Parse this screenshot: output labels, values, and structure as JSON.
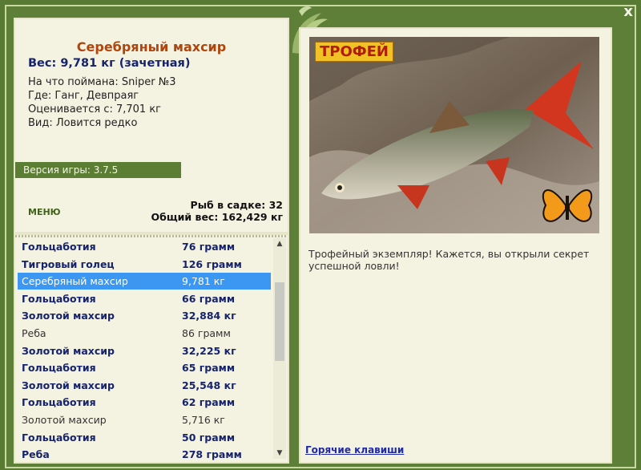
{
  "window": {
    "close_label": "x"
  },
  "fish_card": {
    "title": "Серебряный махсир",
    "weight": "Вес: 9,781 кг (зачетная)",
    "caught_on": "На что поймана: Sniper №3",
    "where": "Где: Ганг, Девпраяг",
    "valued_from": "Оценивается с: 7,701 кг",
    "kind": "Вид: Ловится редко"
  },
  "version_label": "Версия игры: 3.7.5",
  "menu_label": "МЕНЮ",
  "stats": {
    "fish_in_cage": "Рыб в садке: 32",
    "total_weight": "Общий вес: 162,429 кг"
  },
  "catch_list": [
    {
      "name": "Гольцаботия",
      "weight": "76 грамм",
      "style": "bold"
    },
    {
      "name": "Тигровый голец",
      "weight": "126 грамм",
      "style": "bold"
    },
    {
      "name": "Серебряный махсир",
      "weight": "9,781 кг",
      "style": "sel"
    },
    {
      "name": "Гольцаботия",
      "weight": "66 грамм",
      "style": "bold"
    },
    {
      "name": "Золотой махсир",
      "weight": "32,884 кг",
      "style": "bold"
    },
    {
      "name": "Реба",
      "weight": "86 грамм",
      "style": "plain"
    },
    {
      "name": "Золотой махсир",
      "weight": "32,225 кг",
      "style": "bold"
    },
    {
      "name": "Гольцаботия",
      "weight": "65 грамм",
      "style": "bold"
    },
    {
      "name": "Золотой махсир",
      "weight": "25,548 кг",
      "style": "bold"
    },
    {
      "name": "Гольцаботия",
      "weight": "62 грамм",
      "style": "bold"
    },
    {
      "name": "Золотой махсир",
      "weight": "5,716 кг",
      "style": "plain"
    },
    {
      "name": "Гольцаботия",
      "weight": "50 грамм",
      "style": "bold"
    },
    {
      "name": "Реба",
      "weight": "278 грамм",
      "style": "bold"
    }
  ],
  "trophy_badge": "ТРОФЕЙ",
  "description": "Трофейный экземпляр! Кажется, вы открыли секрет успешной ловли!",
  "hotkeys_label": "Горячие клавиши",
  "colors": {
    "frame_green": "#5d7f38",
    "panel_bg": "#f4f3e2",
    "title_orange": "#b0450d",
    "bold_blue": "#16236d",
    "selection": "#3b97f2"
  }
}
